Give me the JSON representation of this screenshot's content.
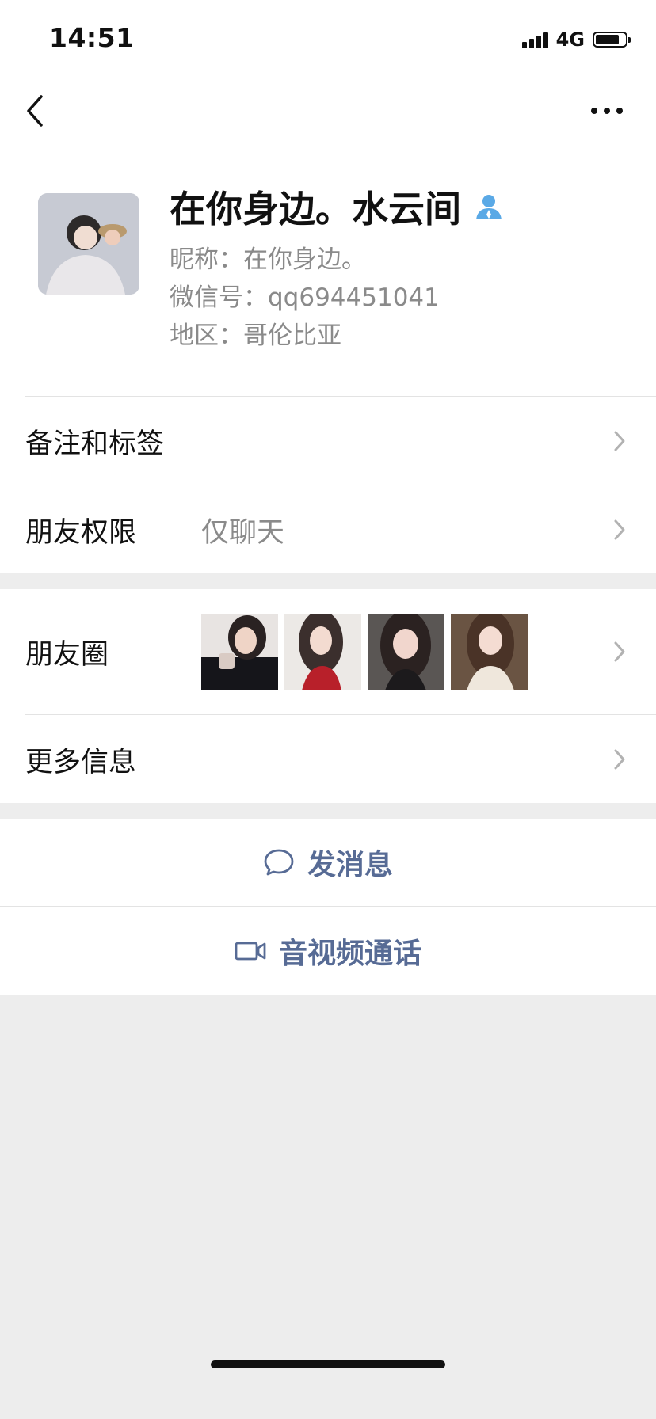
{
  "status_bar": {
    "time": "14:51",
    "network": "4G",
    "battery_level": 0.8
  },
  "profile": {
    "display_name": "在你身边。水云间",
    "nickname": "昵称：在你身边。",
    "wechat_id": "微信号：qq694451041",
    "region": "地区：哥伦比亚"
  },
  "rows": {
    "remarks_label": "备注和标签",
    "permissions_label": "朋友权限",
    "permissions_value": "仅聊天",
    "moments_label": "朋友圈",
    "more_info_label": "更多信息"
  },
  "actions": {
    "send_message": "发消息",
    "video_call": "音视频通话"
  },
  "colors": {
    "link_blue": "#576b95",
    "background": "#ededed",
    "verified_icon": "#5aa9e6"
  },
  "icons": [
    "back-icon",
    "more-icon",
    "contact-person-icon",
    "chevron-right-icon",
    "chat-bubble-icon",
    "video-camera-icon"
  ]
}
